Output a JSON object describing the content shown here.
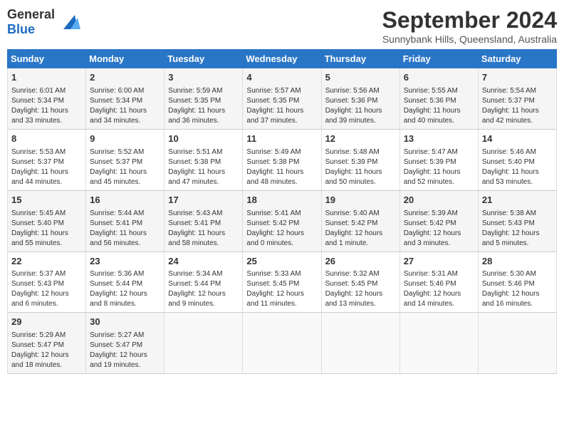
{
  "header": {
    "logo_general": "General",
    "logo_blue": "Blue",
    "month_title": "September 2024",
    "location": "Sunnybank Hills, Queensland, Australia"
  },
  "weekdays": [
    "Sunday",
    "Monday",
    "Tuesday",
    "Wednesday",
    "Thursday",
    "Friday",
    "Saturday"
  ],
  "weeks": [
    [
      {
        "day": "1",
        "sunrise": "Sunrise: 6:01 AM",
        "sunset": "Sunset: 5:34 PM",
        "daylight": "Daylight: 11 hours and 33 minutes."
      },
      {
        "day": "2",
        "sunrise": "Sunrise: 6:00 AM",
        "sunset": "Sunset: 5:34 PM",
        "daylight": "Daylight: 11 hours and 34 minutes."
      },
      {
        "day": "3",
        "sunrise": "Sunrise: 5:59 AM",
        "sunset": "Sunset: 5:35 PM",
        "daylight": "Daylight: 11 hours and 36 minutes."
      },
      {
        "day": "4",
        "sunrise": "Sunrise: 5:57 AM",
        "sunset": "Sunset: 5:35 PM",
        "daylight": "Daylight: 11 hours and 37 minutes."
      },
      {
        "day": "5",
        "sunrise": "Sunrise: 5:56 AM",
        "sunset": "Sunset: 5:36 PM",
        "daylight": "Daylight: 11 hours and 39 minutes."
      },
      {
        "day": "6",
        "sunrise": "Sunrise: 5:55 AM",
        "sunset": "Sunset: 5:36 PM",
        "daylight": "Daylight: 11 hours and 40 minutes."
      },
      {
        "day": "7",
        "sunrise": "Sunrise: 5:54 AM",
        "sunset": "Sunset: 5:37 PM",
        "daylight": "Daylight: 11 hours and 42 minutes."
      }
    ],
    [
      {
        "day": "8",
        "sunrise": "Sunrise: 5:53 AM",
        "sunset": "Sunset: 5:37 PM",
        "daylight": "Daylight: 11 hours and 44 minutes."
      },
      {
        "day": "9",
        "sunrise": "Sunrise: 5:52 AM",
        "sunset": "Sunset: 5:37 PM",
        "daylight": "Daylight: 11 hours and 45 minutes."
      },
      {
        "day": "10",
        "sunrise": "Sunrise: 5:51 AM",
        "sunset": "Sunset: 5:38 PM",
        "daylight": "Daylight: 11 hours and 47 minutes."
      },
      {
        "day": "11",
        "sunrise": "Sunrise: 5:49 AM",
        "sunset": "Sunset: 5:38 PM",
        "daylight": "Daylight: 11 hours and 48 minutes."
      },
      {
        "day": "12",
        "sunrise": "Sunrise: 5:48 AM",
        "sunset": "Sunset: 5:39 PM",
        "daylight": "Daylight: 11 hours and 50 minutes."
      },
      {
        "day": "13",
        "sunrise": "Sunrise: 5:47 AM",
        "sunset": "Sunset: 5:39 PM",
        "daylight": "Daylight: 11 hours and 52 minutes."
      },
      {
        "day": "14",
        "sunrise": "Sunrise: 5:46 AM",
        "sunset": "Sunset: 5:40 PM",
        "daylight": "Daylight: 11 hours and 53 minutes."
      }
    ],
    [
      {
        "day": "15",
        "sunrise": "Sunrise: 5:45 AM",
        "sunset": "Sunset: 5:40 PM",
        "daylight": "Daylight: 11 hours and 55 minutes."
      },
      {
        "day": "16",
        "sunrise": "Sunrise: 5:44 AM",
        "sunset": "Sunset: 5:41 PM",
        "daylight": "Daylight: 11 hours and 56 minutes."
      },
      {
        "day": "17",
        "sunrise": "Sunrise: 5:43 AM",
        "sunset": "Sunset: 5:41 PM",
        "daylight": "Daylight: 11 hours and 58 minutes."
      },
      {
        "day": "18",
        "sunrise": "Sunrise: 5:41 AM",
        "sunset": "Sunset: 5:42 PM",
        "daylight": "Daylight: 12 hours and 0 minutes."
      },
      {
        "day": "19",
        "sunrise": "Sunrise: 5:40 AM",
        "sunset": "Sunset: 5:42 PM",
        "daylight": "Daylight: 12 hours and 1 minute."
      },
      {
        "day": "20",
        "sunrise": "Sunrise: 5:39 AM",
        "sunset": "Sunset: 5:42 PM",
        "daylight": "Daylight: 12 hours and 3 minutes."
      },
      {
        "day": "21",
        "sunrise": "Sunrise: 5:38 AM",
        "sunset": "Sunset: 5:43 PM",
        "daylight": "Daylight: 12 hours and 5 minutes."
      }
    ],
    [
      {
        "day": "22",
        "sunrise": "Sunrise: 5:37 AM",
        "sunset": "Sunset: 5:43 PM",
        "daylight": "Daylight: 12 hours and 6 minutes."
      },
      {
        "day": "23",
        "sunrise": "Sunrise: 5:36 AM",
        "sunset": "Sunset: 5:44 PM",
        "daylight": "Daylight: 12 hours and 8 minutes."
      },
      {
        "day": "24",
        "sunrise": "Sunrise: 5:34 AM",
        "sunset": "Sunset: 5:44 PM",
        "daylight": "Daylight: 12 hours and 9 minutes."
      },
      {
        "day": "25",
        "sunrise": "Sunrise: 5:33 AM",
        "sunset": "Sunset: 5:45 PM",
        "daylight": "Daylight: 12 hours and 11 minutes."
      },
      {
        "day": "26",
        "sunrise": "Sunrise: 5:32 AM",
        "sunset": "Sunset: 5:45 PM",
        "daylight": "Daylight: 12 hours and 13 minutes."
      },
      {
        "day": "27",
        "sunrise": "Sunrise: 5:31 AM",
        "sunset": "Sunset: 5:46 PM",
        "daylight": "Daylight: 12 hours and 14 minutes."
      },
      {
        "day": "28",
        "sunrise": "Sunrise: 5:30 AM",
        "sunset": "Sunset: 5:46 PM",
        "daylight": "Daylight: 12 hours and 16 minutes."
      }
    ],
    [
      {
        "day": "29",
        "sunrise": "Sunrise: 5:29 AM",
        "sunset": "Sunset: 5:47 PM",
        "daylight": "Daylight: 12 hours and 18 minutes."
      },
      {
        "day": "30",
        "sunrise": "Sunrise: 5:27 AM",
        "sunset": "Sunset: 5:47 PM",
        "daylight": "Daylight: 12 hours and 19 minutes."
      },
      null,
      null,
      null,
      null,
      null
    ]
  ]
}
